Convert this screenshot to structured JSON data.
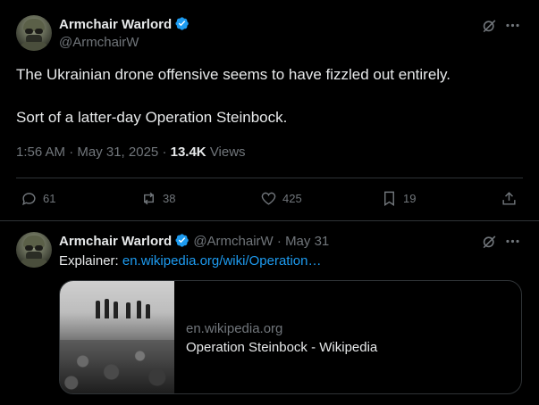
{
  "main_tweet": {
    "author_name": "Armchair Warlord",
    "author_handle": "@ArmchairW",
    "text_line1": "The Ukrainian drone offensive seems to have fizzled out entirely.",
    "text_line2": "Sort of a latter-day Operation Steinbock.",
    "timestamp": "1:56 AM · May 31, 2025",
    "meta_separator": "·",
    "views_count": "13.4K",
    "views_label": "Views",
    "actions": {
      "replies": "61",
      "reposts": "38",
      "likes": "425",
      "bookmarks": "19"
    }
  },
  "reply_tweet": {
    "author_name": "Armchair Warlord",
    "author_handle": "@ArmchairW",
    "dot": "·",
    "date": "May 31",
    "text_prefix": "Explainer:",
    "link_text": "en.wikipedia.org/wiki/Operation…",
    "card": {
      "domain": "en.wikipedia.org",
      "title": "Operation Steinbock - Wikipedia"
    }
  },
  "colors": {
    "background": "#000000",
    "text": "#e7e9ea",
    "muted": "#71767b",
    "link": "#1d9bf0",
    "verified": "#1d9bf0",
    "divider": "#2f3336"
  },
  "icons": [
    "verified-badge-icon",
    "grok-icon",
    "more-icon",
    "reply-icon",
    "repost-icon",
    "like-icon",
    "bookmark-icon",
    "share-icon"
  ]
}
